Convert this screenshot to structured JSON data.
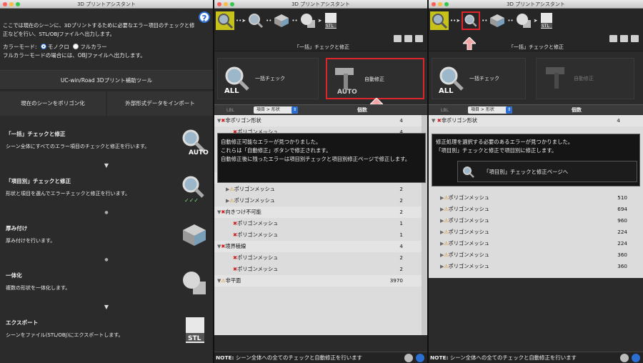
{
  "panel1": {
    "title": "3D プリントアシスタント",
    "intro": "ここでは現在のシーンに、3Dプリントするために必要なエラー項目のチェックと修正などを行い、STL/OBJファイルへ出力します。",
    "color_mode_label": "カラーモード:",
    "mono": "モノクロ",
    "full": "フルカラー",
    "full_note": "フルカラーモードの場合には、OBJファイルへ出力します。",
    "tool_button": "UC-win/Road 3Dプリント補助ツール",
    "polygonize": "現在のシーンをポリゴン化",
    "import": "外部形式データをインポート",
    "steps": [
      {
        "title": "「一括」チェックと修正",
        "desc": "シーン全体にすべてのエラー項目のチェックと修正を行います。",
        "icon": "auto-check-icon"
      },
      {
        "title": "「項目別」チェックと修正",
        "desc": "形状と項目を選んでエラーチェックと修正を行います。",
        "icon": "item-check-icon"
      },
      {
        "title": "厚み付け",
        "desc": "厚み付けを行います。",
        "icon": "thickness-icon"
      },
      {
        "title": "一体化",
        "desc": "複数の形状を一体化します。",
        "icon": "merge-icon"
      },
      {
        "title": "エクスポート",
        "desc": "シーンをファイル(STL/OBJ)にエクスポートします。",
        "icon": "stl-export-icon"
      }
    ]
  },
  "panel2": {
    "title": "3D プリントアシスタント",
    "caption": "「一括」チェックと修正",
    "tile_check": "一括チェック",
    "tile_fix": "自動修正",
    "combo": "項目 > 形状",
    "col_count": "個数",
    "popup_lines": [
      "自動修正可能なエラーが見つかりました。",
      "これらは「自動修正」ボタンで修正されます。",
      "自動修正後に残ったエラーは項目別チェックと項目別修正ページで修正します。"
    ],
    "rows": [
      {
        "level": 0,
        "mark": "x",
        "label": "非ポリゴン形状",
        "value": "4"
      },
      {
        "level": 1,
        "mark": "x",
        "label": "ポリゴンメッシュ",
        "value": "4"
      },
      {
        "level": 1,
        "mark": "x",
        "label": "ポリゴンメッシュ",
        "value": "2"
      },
      {
        "level": 1,
        "mark": "x",
        "label": "ポリゴンメッシュ",
        "value": "64"
      },
      {
        "level": 1,
        "mark": "x",
        "label": "ポリゴンメッシュ",
        "value": "64"
      },
      {
        "level": 0,
        "mark": "warn",
        "label": "不連続面の数",
        "value": "4"
      },
      {
        "level": 1,
        "mark": "warn",
        "label": "ポリゴンメッシュ",
        "value": "2"
      },
      {
        "level": 1,
        "mark": "warn",
        "label": "ポリゴンメッシュ",
        "value": "2"
      },
      {
        "level": 0,
        "mark": "x",
        "label": "向きつけ不可能",
        "value": "2"
      },
      {
        "level": 1,
        "mark": "x",
        "label": "ポリゴンメッシュ",
        "value": "1"
      },
      {
        "level": 1,
        "mark": "x",
        "label": "ポリゴンメッシュ",
        "value": "1"
      },
      {
        "level": 0,
        "mark": "x",
        "label": "境界稜線",
        "value": "4"
      },
      {
        "level": 1,
        "mark": "x",
        "label": "ポリゴンメッシュ",
        "value": "2"
      },
      {
        "level": 1,
        "mark": "x",
        "label": "ポリゴンメッシュ",
        "value": "2"
      },
      {
        "level": 0,
        "mark": "warn",
        "label": "非平面",
        "value": "3970"
      }
    ],
    "status": "NOTE:",
    "status_text": "シーン全体への全てのチェックと自動修正を行います"
  },
  "panel3": {
    "title": "3D プリントアシスタント",
    "caption": "「一括」チェックと修正",
    "tile_check": "一括チェック",
    "tile_fix": "自動修正",
    "combo": "項目 > 形状",
    "col_count": "個数",
    "popup_lines": [
      "修正処理を選択する必要のあるエラーが見つかりました。",
      "「項目別」チェックと修正で項目別に修正します。"
    ],
    "popup_button": "「項目別」チェックと修正ページへ",
    "top_row": {
      "label": "非ポリゴン形状",
      "value": "4"
    },
    "rows": [
      {
        "label": "ポリゴンメッシュ",
        "value": "510"
      },
      {
        "label": "ポリゴンメッシュ",
        "value": "694"
      },
      {
        "label": "ポリゴンメッシュ",
        "value": "960"
      },
      {
        "label": "ポリゴンメッシュ",
        "value": "224"
      },
      {
        "label": "ポリゴンメッシュ",
        "value": "224"
      },
      {
        "label": "ポリゴンメッシュ",
        "value": "360"
      },
      {
        "label": "ポリゴンメッシュ",
        "value": "360"
      }
    ],
    "status": "NOTE:",
    "status_text": "シーン全体への全てのチェックと自動修正を行います"
  },
  "colors": {
    "accent": "#2a6fd1",
    "error": "#d01919",
    "warning": "#e08a00",
    "highlight": "#e0242b",
    "pointer": "#f4a6a6"
  }
}
